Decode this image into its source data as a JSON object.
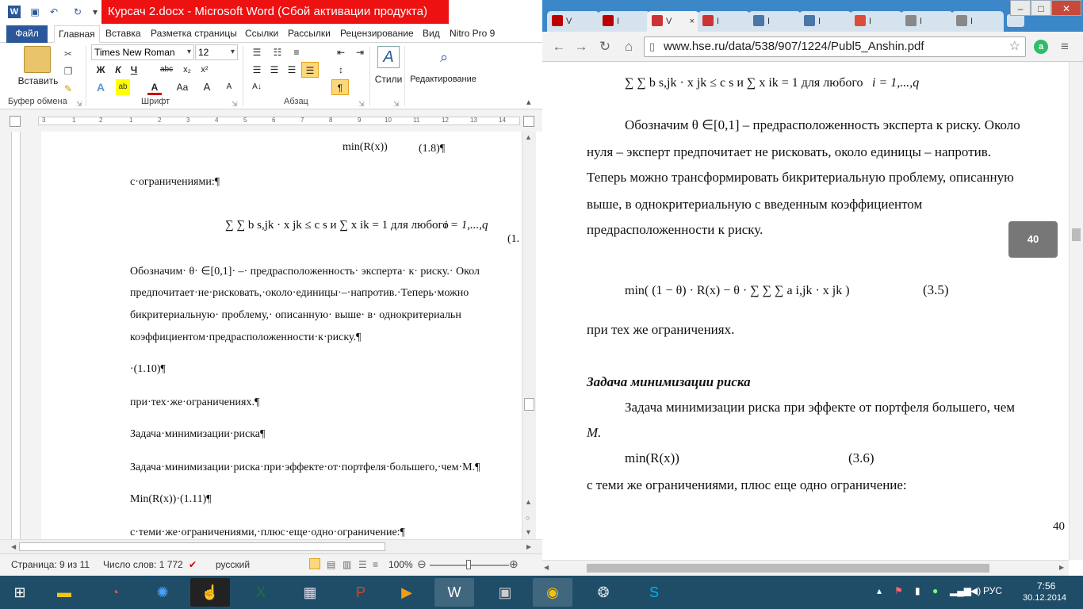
{
  "word": {
    "title": "Курсач 2.docx - Microsoft Word (Сбой активации продукта)",
    "tabs": [
      "Файл",
      "Главная",
      "Вставка",
      "Разметка страницы",
      "Ссылки",
      "Рассылки",
      "Рецензирование",
      "Вид",
      "Nitro Pro 9"
    ],
    "ribbon": {
      "paste_label": "Вставить",
      "font_name": "Times New Roman",
      "font_size": "12",
      "group_clipboard": "Буфер обмена",
      "group_font": "Шрифт",
      "group_paragraph": "Абзац",
      "styles_label": "Стили",
      "editing_label": "Редактирование",
      "bold": "Ж",
      "italic": "К",
      "underline": "Ч",
      "strike": "abc",
      "sub": "x₂",
      "sup": "x²",
      "font_color": "A",
      "case": "Aa",
      "grow": "A",
      "shrink": "A",
      "pilcrow": "¶"
    },
    "doc": {
      "line1_formula": "min(R(x))",
      "line1_num": "(1.8)¶",
      "line2": "с·ограничениями:¶",
      "line3_formula": "∑ ∑ b s,jk · x jk ≤ c s  и  ∑ x ik = 1  для любого",
      "line3_tail": "i = 1,...,q",
      "line3_num": "(1.",
      "para1": "Обозначим· θ· ∈[0,1]· –· предрасположенность· эксперта· к· риску.· Окол",
      "para2": "предпочитает·не·рисковать,·около·единицы·–·напротив.·Теперь·можно",
      "para3": "бикритериальную·  проблему,·  описанную·  выше·  в·  однокритериальн",
      "para4": "коэффициентом·предрасположенности·к·риску.¶",
      "line4": "·(1.10)¶",
      "line5": "при·тех·же·ограничениях.¶",
      "line6": "Задача·минимизации·риска¶",
      "line7": "Задача·минимизации·риска·при·эффекте·от·портфеля·большего,·чем·М.¶",
      "line8": "Min(R(x))·(1.11)¶",
      "line9": "с·теми·же·ограничениями,·плюс·еще·одно·ограничение:¶"
    },
    "status": {
      "page": "Страница: 9 из 11",
      "words": "Число слов: 1 772",
      "lang": "русский",
      "zoom": "100%"
    }
  },
  "chrome": {
    "url": "www.hse.ru/data/538/907/1224/Publ5_Anshin.pdf",
    "tabs": [
      {
        "label": "V",
        "color": "#b00"
      },
      {
        "label": "I",
        "color": "#b00"
      },
      {
        "label": "V",
        "color": "#c33"
      },
      {
        "label": "I",
        "color": "#c33"
      },
      {
        "label": "I",
        "color": "#4a76a8"
      },
      {
        "label": "I",
        "color": "#4a76a8"
      },
      {
        "label": "I",
        "color": "#dd4b39"
      },
      {
        "label": "I",
        "color": "#888"
      },
      {
        "label": "I",
        "color": "#888"
      }
    ],
    "pdf": {
      "top_formula": "∑ ∑ b s,jk · x jk ≤ c s  и  ∑ x ik = 1  для любого",
      "top_tail": "i = 1,...,q",
      "p1_line1": "Обозначим  θ ∈[0,1]  – предрасположенность эксперта к риску. Около",
      "p1_line2": "нуля – эксперт предпочитает не рисковать, около единицы – напротив.",
      "p1_line3": "Теперь можно трансформировать бикритериальную проблему, описанную",
      "p1_line4": "выше,       в       однокритериальную       с       введенным       коэффициентом",
      "p1_line5": "предрасположенности к риску.",
      "formula35": "min( (1 − θ) · R(x) − θ · ∑ ∑ ∑ a i,jk · x jk )",
      "num35": "(3.5)",
      "same": " при тех же ограничениях.",
      "heading": "Задача минимизации риска",
      "p2_line1": "Задача минимизации риска при эффекте от портфеля большего, чем",
      "p2_line2": "M.",
      "formula36": "min(R(x))",
      "num36": "(3.6)",
      "last": "с теми же ограничениями, плюс еще одно ограничение:",
      "page_num": "40",
      "badge": "40"
    }
  },
  "taskbar": {
    "lang": "РУС",
    "time": "7:56",
    "date": "30.12.2014"
  }
}
